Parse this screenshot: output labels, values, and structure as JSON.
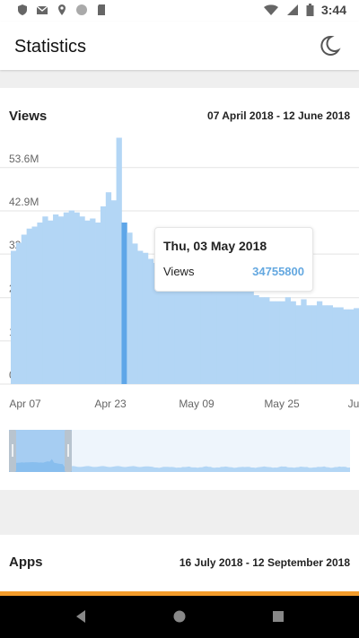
{
  "status_bar": {
    "time": "3:44",
    "left_icons": [
      "shield-icon",
      "gmail-icon",
      "location-icon",
      "circle-icon",
      "sd-card-icon"
    ],
    "right_icons": [
      "wifi-icon",
      "signal-icon",
      "battery-icon"
    ]
  },
  "app_bar": {
    "title": "Statistics",
    "theme_icon": "moon-icon"
  },
  "views_card": {
    "title": "Views",
    "date_range": "07 April 2018 - 12 June 2018",
    "tooltip": {
      "date": "Thu, 03 May 2018",
      "label": "Views",
      "value": "34755800"
    }
  },
  "apps_card": {
    "title": "Apps",
    "date_range": "16 July 2018 - 12 September 2018"
  },
  "colors": {
    "bar": "#b3d6f5",
    "bar_selected": "#5ea6e8",
    "tooltip_value": "#64a8e0",
    "accent_line": "#f39c2b"
  },
  "chart_data": {
    "type": "bar",
    "title": "Views",
    "y_tick_labels": [
      "0",
      "10.7M",
      "21.4M",
      "32.2M",
      "42.9M",
      "53.6M"
    ],
    "y_ticks": [
      0,
      10.7,
      21.4,
      32.2,
      42.9,
      53.6
    ],
    "x_tick_labels": [
      "Apr 07",
      "Apr 23",
      "May 09",
      "May 25",
      "Ju"
    ],
    "ylim": [
      0,
      60
    ],
    "unit": "millions of views",
    "values": [
      33,
      35,
      37,
      38.5,
      39,
      40,
      41.5,
      40.5,
      42,
      41.5,
      42.5,
      43,
      42.5,
      41.5,
      40.5,
      41,
      40,
      44,
      47.5,
      45.5,
      61,
      40,
      37.5,
      34.8,
      33,
      32.5,
      31,
      30,
      28,
      28.5,
      27,
      26.5,
      25.5,
      23.5,
      23,
      24,
      24.5,
      23.5,
      23.5,
      23,
      23,
      23.2,
      23.5,
      24,
      24.5,
      23.8,
      22,
      21.5,
      21.5,
      20.5,
      20.5,
      20.5,
      21.5,
      20.5,
      19.5,
      21,
      19.5,
      19.5,
      20.5,
      19.5,
      19.5,
      19,
      19,
      18.5,
      18.5,
      18.8
    ],
    "selected_index": 21,
    "selected_value": 34755800
  }
}
